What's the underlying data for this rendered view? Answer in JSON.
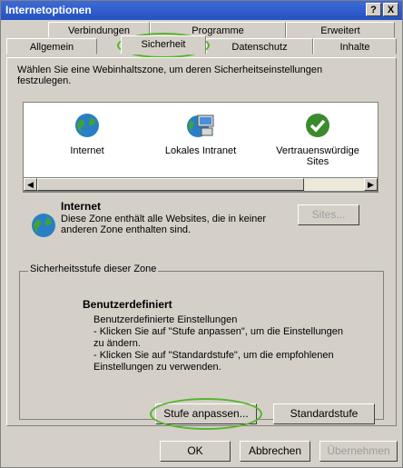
{
  "window": {
    "title": "Internetoptionen"
  },
  "titlebar_buttons": {
    "help": "?",
    "close": "X"
  },
  "tabs": {
    "row1": [
      "Verbindungen",
      "Programme",
      "Erweitert"
    ],
    "row2": [
      "Allgemein",
      "Sicherheit",
      "Datenschutz",
      "Inhalte"
    ],
    "active": "Sicherheit"
  },
  "intro": {
    "line1": "Wählen Sie eine Webinhaltszone, um deren Sicherheitseinstellungen",
    "line2": "festzulegen."
  },
  "zones": [
    {
      "label": "Internet",
      "icon": "globe-icon"
    },
    {
      "label": "Lokales Intranet",
      "icon": "intranet-icon"
    },
    {
      "label_line1": "Vertrauenswürdige",
      "label_line2": "Sites",
      "icon": "checkmark-icon"
    }
  ],
  "zone_info": {
    "title": "Internet",
    "line1": "Diese Zone enthält alle Websites, die in keiner",
    "line2": "anderen Zone enthalten sind.",
    "sites_button": "Sites..."
  },
  "security_level": {
    "group_label": "Sicherheitsstufe dieser Zone",
    "title": "Benutzerdefiniert",
    "lines": [
      "Benutzerdefinierte Einstellungen",
      "- Klicken Sie auf \"Stufe anpassen\", um die Einstellungen",
      "zu ändern.",
      "- Klicken Sie auf \"Standardstufe\", um die empfohlenen",
      "Einstellungen zu verwenden."
    ],
    "custom_button": "Stufe anpassen...",
    "default_button": "Standardstufe"
  },
  "dialog_buttons": {
    "ok": "OK",
    "cancel": "Abbrechen",
    "apply": "Übernehmen"
  },
  "colors": {
    "title_bar": "#2452c0",
    "highlight_oval": "#55b52a",
    "dialog_bg": "#d4d0c8"
  }
}
